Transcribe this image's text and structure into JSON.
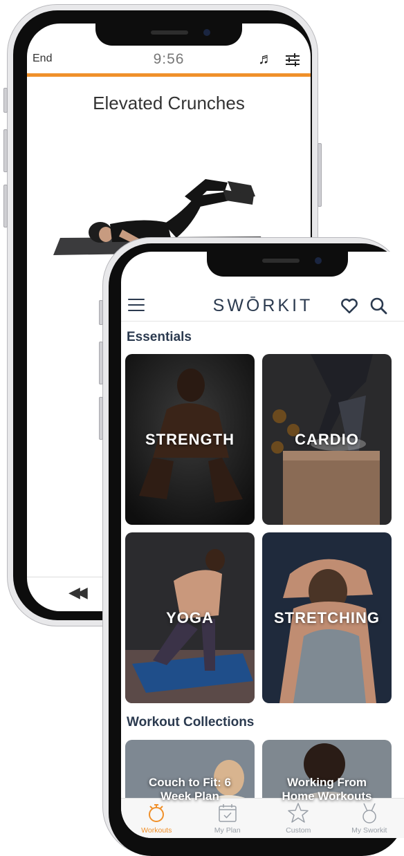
{
  "workout_screen": {
    "end_label": "End",
    "timer": "9:56",
    "music_icon": "music-note-icon",
    "settings_icon": "sliders-icon",
    "exercise_title": "Elevated Crunches",
    "rewind_icon": "rewind-icon",
    "progress_color": "#f0902a"
  },
  "home_screen": {
    "logo": "SWŌRKIT",
    "menu_icon": "hamburger-menu-icon",
    "favorites_icon": "heart-icon",
    "search_icon": "search-icon",
    "essentials_heading": "Essentials",
    "essentials": [
      {
        "label": "STRENGTH"
      },
      {
        "label": "CARDIO"
      },
      {
        "label": "YOGA"
      },
      {
        "label": "STRETCHING"
      }
    ],
    "collections_heading": "Workout Collections",
    "collections": [
      {
        "label": "Couch to Fit: 6\nWeek Plan"
      },
      {
        "label": "Working From\nHome Workouts"
      }
    ],
    "tabs": [
      {
        "label": "Workouts",
        "icon": "stopwatch-icon",
        "active": true
      },
      {
        "label": "My Plan",
        "icon": "calendar-icon",
        "active": false
      },
      {
        "label": "Custom",
        "icon": "star-icon",
        "active": false
      },
      {
        "label": "My Sworkit",
        "icon": "medal-icon",
        "active": false
      }
    ],
    "accent_color": "#f0902a",
    "heading_color": "#2b3a4f"
  }
}
